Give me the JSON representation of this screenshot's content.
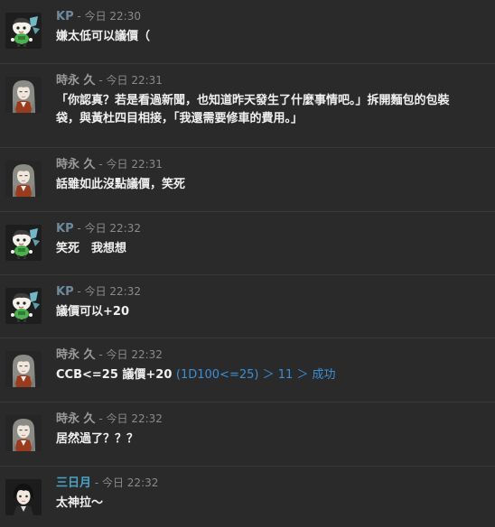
{
  "messages": [
    {
      "author": "KP",
      "separator": " - ",
      "timestamp": "今日 22:30",
      "text": "嫌太低可以議價（"
    },
    {
      "author": "時永 久",
      "separator": " - ",
      "timestamp": "今日 22:31",
      "text_line1": "「你認真？若是看過新聞，也知道昨天發生了什麼事情吧。」拆開麵包的包裝",
      "text_line2": "袋，與黃杜四目相接，「我還需要修車的費用。」"
    },
    {
      "author": "時永 久",
      "separator": " - ",
      "timestamp": "今日 22:31",
      "text": "話雖如此沒點議價，笑死"
    },
    {
      "author": "KP",
      "separator": " - ",
      "timestamp": "今日 22:32",
      "text": "笑死　我想想"
    },
    {
      "author": "KP",
      "separator": " - ",
      "timestamp": "今日 22:32",
      "text": "議價可以+20"
    },
    {
      "author": "時永 久",
      "separator": " - ",
      "timestamp": "今日 22:32",
      "text": "CCB<=25 議價+20 ",
      "dice": "(1D100<=25) ＞ 11 ＞ 成功"
    },
    {
      "author": "時永 久",
      "separator": " - ",
      "timestamp": "今日 22:32",
      "text": "居然過了？？？"
    },
    {
      "author": "三日月",
      "separator": " - ",
      "timestamp": "今日 22:32",
      "text": "太神拉〜"
    }
  ],
  "colors": {
    "background": "#2a2a2a",
    "divider": "#3a3a3a",
    "kp_name": "#6e8a9e",
    "tokinaga_name": "#9a9a9a",
    "mikazuki_name": "#4aa3c4",
    "dice_result": "#3b8fd6"
  },
  "icons": {
    "kp": "chibi-character-avatar-icon",
    "tokinaga": "long-haired-character-avatar-icon",
    "mikazuki": "dark-haired-character-avatar-icon"
  }
}
